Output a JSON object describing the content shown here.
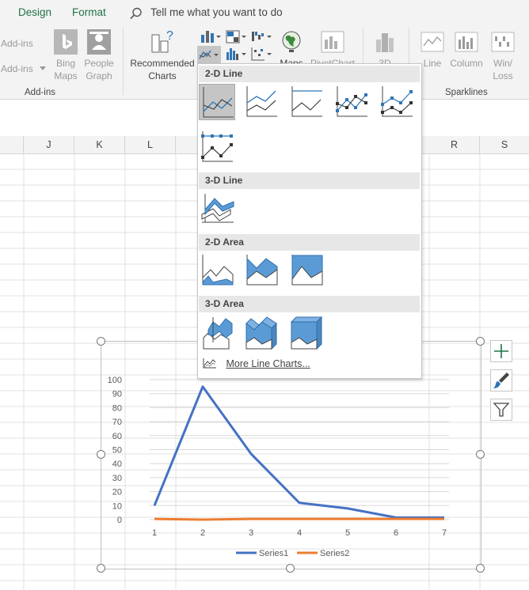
{
  "ribbon": {
    "tabs": [
      "Design",
      "Format"
    ],
    "tell_me": "Tell me what you want to do",
    "addins_top": "Add-ins",
    "addins_bottom": "Add-ins",
    "bing_maps": [
      "Bing",
      "Maps"
    ],
    "people_graph": [
      "People",
      "Graph"
    ],
    "recommended_charts": [
      "Recommended",
      "Charts"
    ],
    "maps": "Maps",
    "pivotchart": "PivotChart",
    "three_d": "3D",
    "sparkline_line": "Line",
    "sparkline_column": "Column",
    "sparkline_winloss": [
      "Win/",
      "Loss"
    ],
    "group_addins": "Add-ins",
    "group_sparklines": "Sparklines"
  },
  "columns": [
    "J",
    "K",
    "L",
    "R",
    "S"
  ],
  "dropdown": {
    "sections": [
      "2-D Line",
      "3-D Line",
      "2-D Area",
      "3-D Area"
    ],
    "more": "More Line Charts..."
  },
  "chart_data": {
    "type": "line",
    "x": [
      1,
      2,
      3,
      4,
      5,
      6,
      7
    ],
    "xticks": [
      "1",
      "2",
      "3",
      "4",
      "5",
      "6",
      "7"
    ],
    "ylim": [
      0,
      100
    ],
    "yticks": [
      "0",
      "10",
      "20",
      "30",
      "40",
      "50",
      "60",
      "70",
      "80",
      "90",
      "100"
    ],
    "legend_position": "bottom",
    "series": [
      {
        "name": "Series1",
        "color": "#4472c4",
        "values": [
          10,
          95,
          47,
          12,
          8,
          1.5,
          1.5
        ]
      },
      {
        "name": "Series2",
        "color": "#ed7d31",
        "values": [
          0.5,
          0,
          0.5,
          0.5,
          0.5,
          0.5,
          0.5
        ]
      }
    ]
  },
  "colors": {
    "accent": "#217346",
    "series1": "#4472c4",
    "series2": "#ed7d31"
  }
}
